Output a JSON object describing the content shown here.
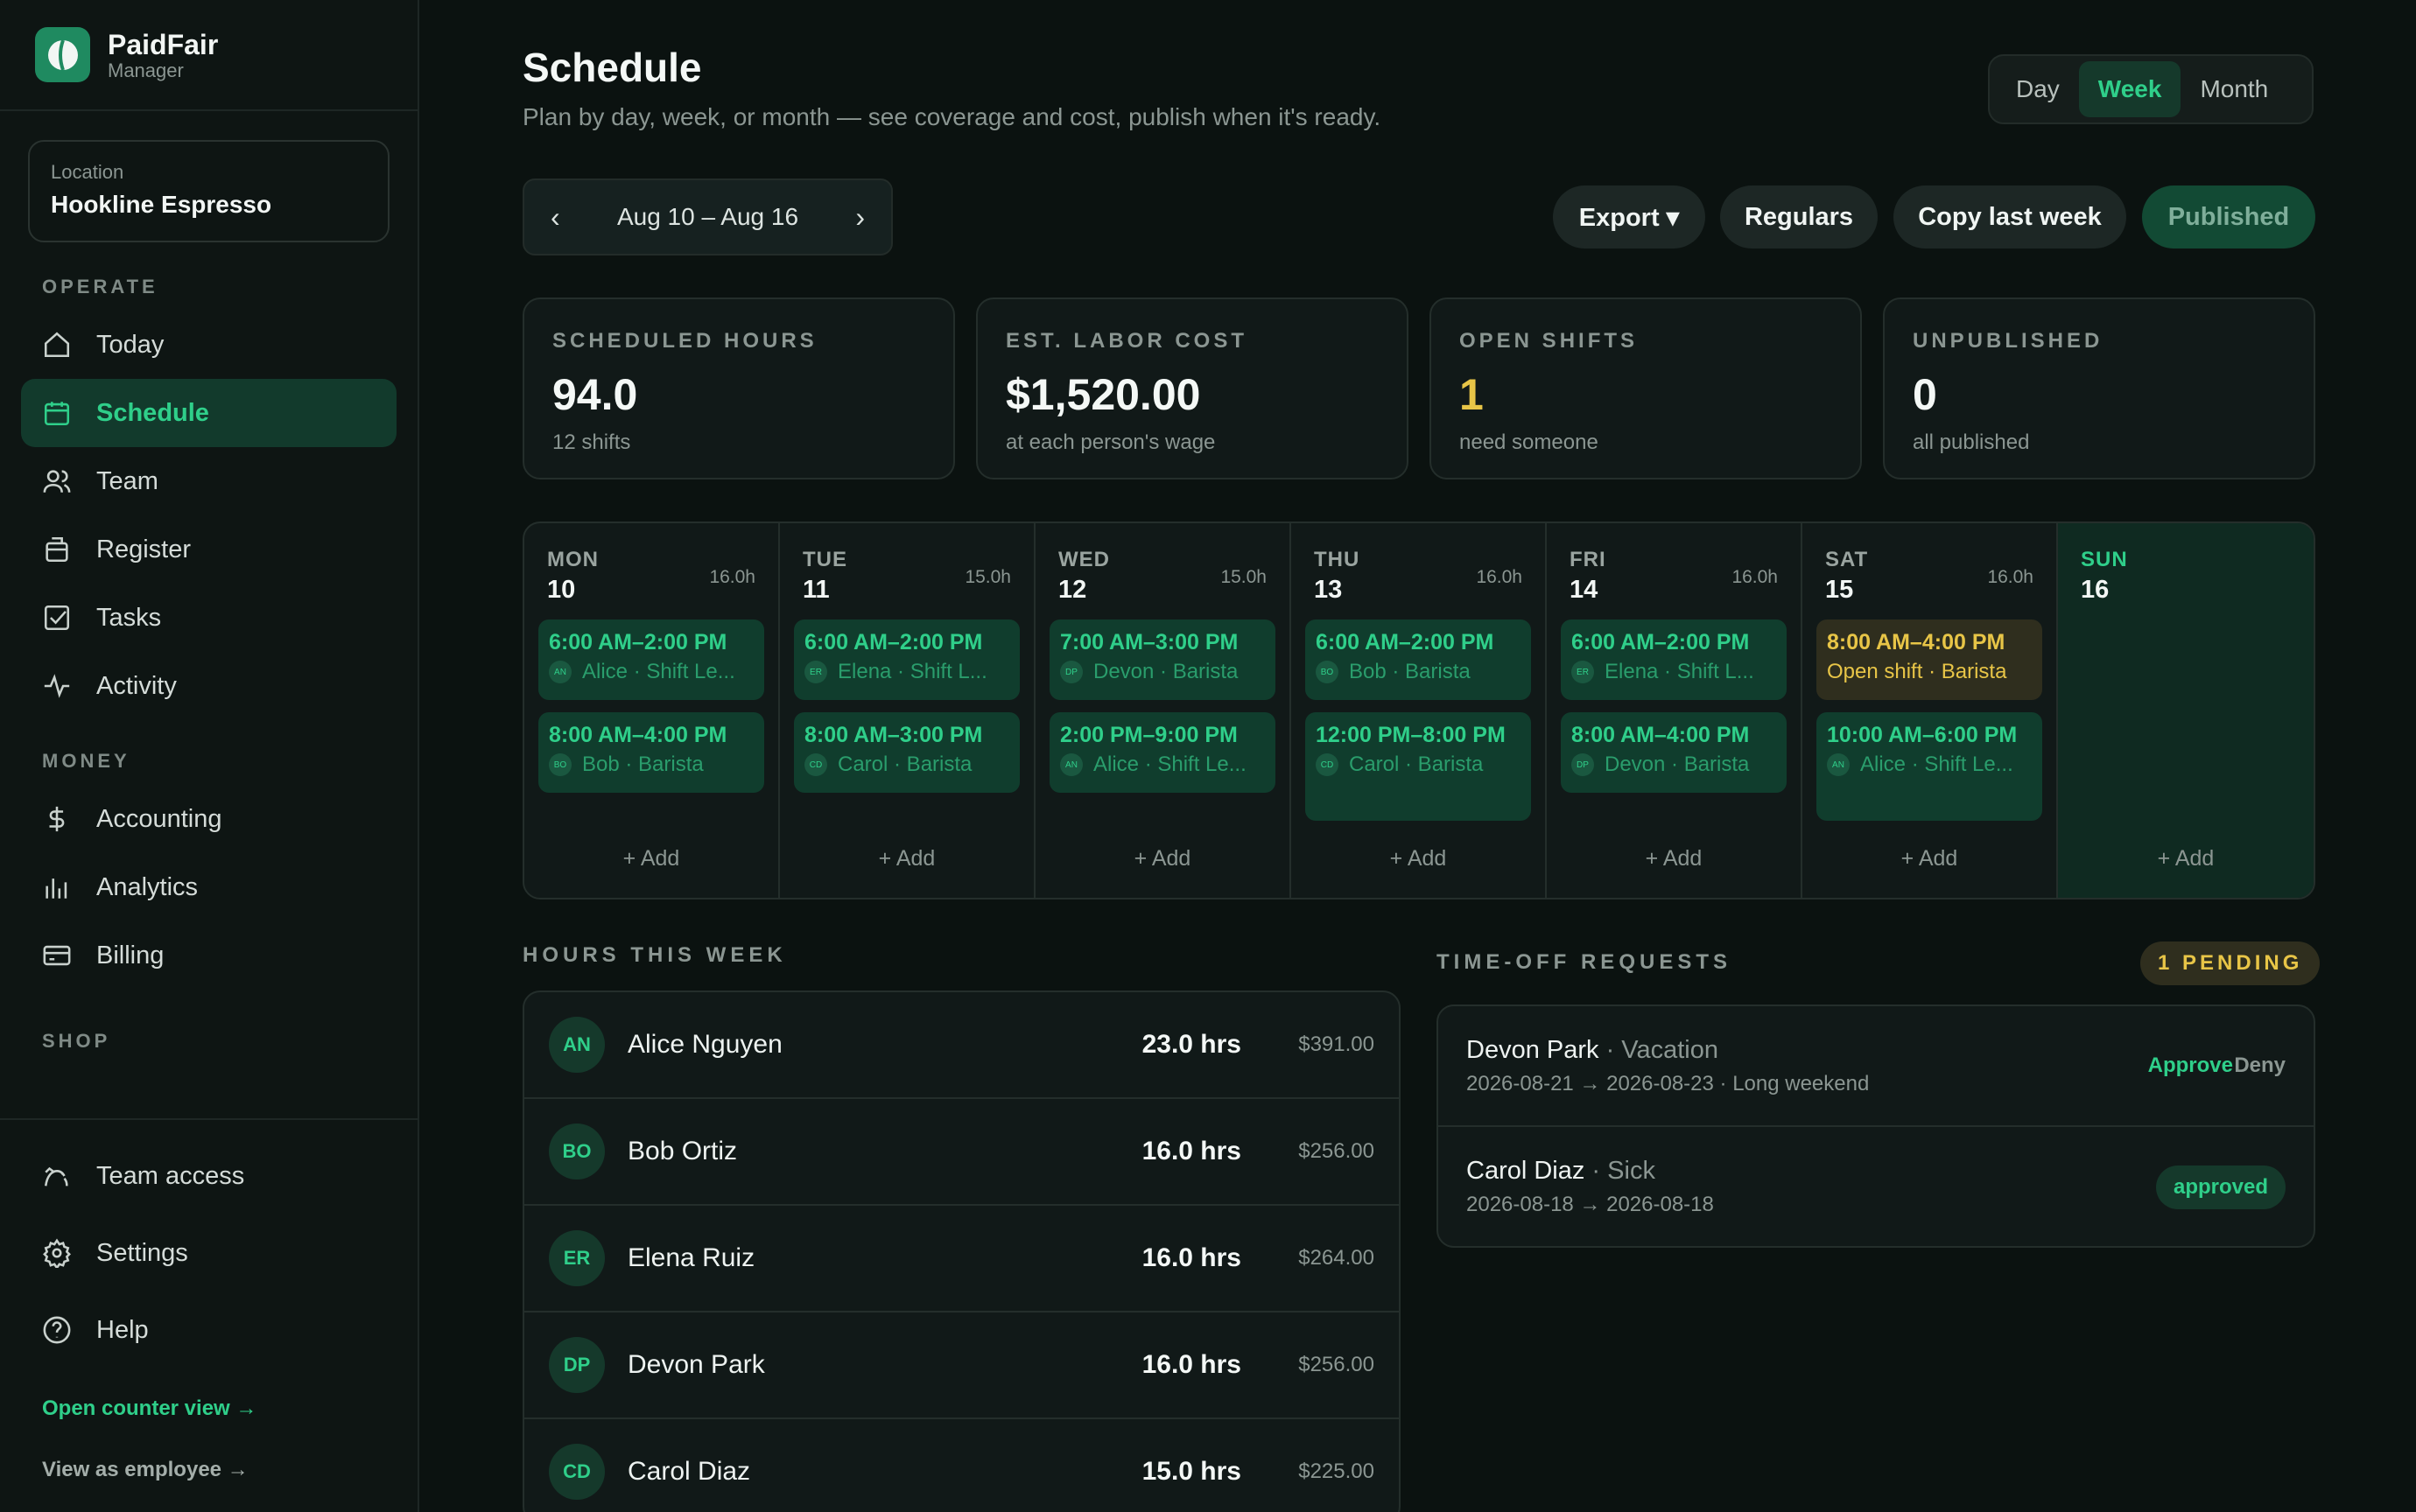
{
  "brand": {
    "name": "PaidFair",
    "role": "Manager"
  },
  "location": {
    "label": "Location",
    "value": "Hookline Espresso"
  },
  "sidebar": {
    "sections": [
      "OPERATE",
      "MONEY",
      "SHOP"
    ],
    "operate": [
      {
        "label": "Today",
        "icon": "home-icon"
      },
      {
        "label": "Schedule",
        "icon": "calendar-icon",
        "active": true
      },
      {
        "label": "Team",
        "icon": "users-icon"
      },
      {
        "label": "Register",
        "icon": "register-icon"
      },
      {
        "label": "Tasks",
        "icon": "checkbox-icon"
      },
      {
        "label": "Activity",
        "icon": "activity-icon"
      }
    ],
    "money": [
      {
        "label": "Accounting",
        "icon": "dollar-icon"
      },
      {
        "label": "Analytics",
        "icon": "bar-chart-icon"
      },
      {
        "label": "Billing",
        "icon": "credit-card-icon"
      }
    ],
    "bottom": [
      {
        "label": "Team access",
        "icon": "team-access-icon"
      },
      {
        "label": "Settings",
        "icon": "gear-icon"
      },
      {
        "label": "Help",
        "icon": "help-icon"
      }
    ],
    "open_counter": "Open counter view →",
    "view_employee": "View as employee →"
  },
  "header": {
    "title": "Schedule",
    "subtitle": "Plan by day, week, or month — see coverage and cost, publish when it's ready.",
    "views": [
      "Day",
      "Week",
      "Month"
    ],
    "active_view": "Week"
  },
  "toolbar": {
    "date_range": "Aug 10 – Aug 16",
    "prev": "‹",
    "next": "›",
    "export": "Export ▾",
    "regulars": "Regulars",
    "copy_last_week": "Copy last week",
    "published": "Published"
  },
  "stats": [
    {
      "label": "SCHEDULED HOURS",
      "value": "94.0",
      "sub": "12 shifts"
    },
    {
      "label": "EST. LABOR COST",
      "value": "$1,520.00",
      "sub": "at each person's wage"
    },
    {
      "label": "OPEN SHIFTS",
      "value": "1",
      "sub": "need someone"
    },
    {
      "label": "UNPUBLISHED",
      "value": "0",
      "sub": "all published"
    }
  ],
  "week": [
    {
      "day": "MON",
      "num": "10",
      "hours": "16.0h",
      "shifts": [
        {
          "time": "6:00 AM–2:00 PM",
          "who": "Alice · Shift Le...",
          "av": "AN"
        },
        {
          "time": "8:00 AM–4:00 PM",
          "who": "Bob · Barista",
          "av": "BO"
        }
      ]
    },
    {
      "day": "TUE",
      "num": "11",
      "hours": "15.0h",
      "shifts": [
        {
          "time": "6:00 AM–2:00 PM",
          "who": "Elena · Shift L...",
          "av": "ER"
        },
        {
          "time": "8:00 AM–3:00 PM",
          "who": "Carol · Barista",
          "av": "CD"
        }
      ]
    },
    {
      "day": "WED",
      "num": "12",
      "hours": "15.0h",
      "shifts": [
        {
          "time": "7:00 AM–3:00 PM",
          "who": "Devon · Barista",
          "av": "DP"
        },
        {
          "time": "2:00 PM–9:00 PM",
          "who": "Alice · Shift Le...",
          "av": "AN"
        }
      ]
    },
    {
      "day": "THU",
      "num": "13",
      "hours": "16.0h",
      "shifts": [
        {
          "time": "6:00 AM–2:00 PM",
          "who": "Bob · Barista",
          "av": "BO"
        },
        {
          "time": "12:00 PM–8:00 PM",
          "who": "Carol · Barista",
          "av": "CD"
        }
      ]
    },
    {
      "day": "FRI",
      "num": "14",
      "hours": "16.0h",
      "shifts": [
        {
          "time": "6:00 AM–2:00 PM",
          "who": "Elena · Shift L...",
          "av": "ER"
        },
        {
          "time": "8:00 AM–4:00 PM",
          "who": "Devon · Barista",
          "av": "DP"
        }
      ]
    },
    {
      "day": "SAT",
      "num": "15",
      "hours": "16.0h",
      "shifts": [
        {
          "time": "8:00 AM–4:00 PM",
          "who": "Open shift · Barista",
          "av": ""
        },
        {
          "time": "10:00 AM–6:00 PM",
          "who": "Alice · Shift Le...",
          "av": "AN"
        }
      ]
    },
    {
      "day": "SUN",
      "num": "16",
      "hours": "",
      "shifts": []
    }
  ],
  "add_label": "+ Add",
  "hours_this_week": {
    "title": "HOURS THIS WEEK",
    "rows": [
      {
        "av": "AN",
        "name": "Alice Nguyen",
        "hrs": "23.0 hrs",
        "cost": "$391.00"
      },
      {
        "av": "BO",
        "name": "Bob Ortiz",
        "hrs": "16.0 hrs",
        "cost": "$256.00"
      },
      {
        "av": "ER",
        "name": "Elena Ruiz",
        "hrs": "16.0 hrs",
        "cost": "$264.00"
      },
      {
        "av": "DP",
        "name": "Devon Park",
        "hrs": "16.0 hrs",
        "cost": "$256.00"
      },
      {
        "av": "CD",
        "name": "Carol Diaz",
        "hrs": "15.0 hrs",
        "cost": "$225.00"
      }
    ]
  },
  "time_off": {
    "title": "TIME-OFF REQUESTS",
    "pending": "1 PENDING",
    "requests": [
      {
        "name": "Devon Park",
        "kind": "Vacation",
        "dates": "2026-08-21 → 2026-08-23 · Long weekend",
        "approve": "Approve",
        "deny": "Deny"
      },
      {
        "name": "Carol Diaz",
        "kind": "Sick",
        "dates": "2026-08-18 → 2026-08-18",
        "status": "approved"
      }
    ]
  },
  "colors": {
    "accent": "#2fcf8a",
    "warning": "#e8c547",
    "bg": "#0b1210"
  }
}
